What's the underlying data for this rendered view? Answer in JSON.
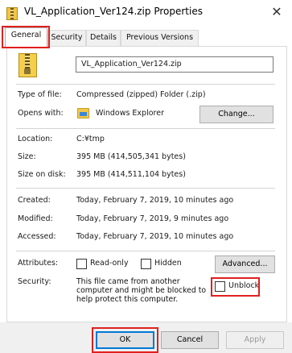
{
  "window": {
    "title": "VL_Application_Ver124.zip Properties",
    "close_glyph": "✕"
  },
  "tabs": [
    {
      "label": "General",
      "active": true
    },
    {
      "label": "Security",
      "active": false
    },
    {
      "label": "Details",
      "active": false
    },
    {
      "label": "Previous Versions",
      "active": false
    }
  ],
  "file": {
    "name": "VL_Application_Ver124.zip",
    "icon": "zip-folder-icon"
  },
  "props": {
    "type_label": "Type of file:",
    "type_value": "Compressed (zipped) Folder (.zip)",
    "opens_label": "Opens with:",
    "opens_value": "Windows Explorer",
    "opens_icon": "windows-explorer-icon",
    "change_button": "Change...",
    "location_label": "Location:",
    "location_value": "C:¥tmp",
    "size_label": "Size:",
    "size_value": "395 MB (414,505,341 bytes)",
    "size_disk_label": "Size on disk:",
    "size_disk_value": "395 MB (414,511,104 bytes)",
    "created_label": "Created:",
    "created_value": "Today, February 7, 2019, 10 minutes ago",
    "modified_label": "Modified:",
    "modified_value": "Today, February 7, 2019, 9 minutes ago",
    "accessed_label": "Accessed:",
    "accessed_value": "Today, February 7, 2019, 10 minutes ago"
  },
  "attributes": {
    "label": "Attributes:",
    "readonly_label": "Read-only",
    "readonly_checked": false,
    "hidden_label": "Hidden",
    "hidden_checked": false,
    "advanced_button": "Advanced..."
  },
  "security": {
    "label": "Security:",
    "text": "This file came from another computer and might be blocked to help protect this computer.",
    "unblock_label": "Unblock",
    "unblock_checked": false
  },
  "buttons": {
    "ok": "OK",
    "cancel": "Cancel",
    "apply": "Apply"
  },
  "colors": {
    "highlight": "#e02020",
    "default_button_border": "#0078d7"
  }
}
